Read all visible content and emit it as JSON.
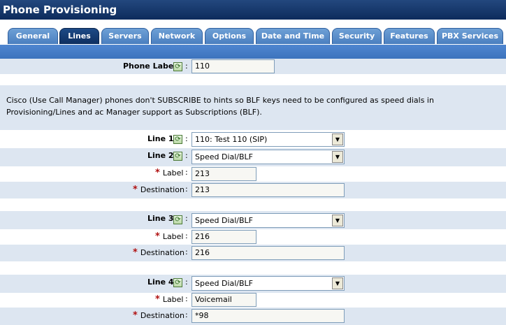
{
  "header": {
    "title": "Phone Provisioning"
  },
  "tabs": [
    {
      "label": "General"
    },
    {
      "label": "Lines"
    },
    {
      "label": "Servers"
    },
    {
      "label": "Network"
    },
    {
      "label": "Options"
    },
    {
      "label": "Date and Time"
    },
    {
      "label": "Security"
    },
    {
      "label": "Features"
    },
    {
      "label": "PBX Services"
    }
  ],
  "active_tab": "Lines",
  "phone_label": {
    "label": "Phone Label",
    "value": "110"
  },
  "notice": "Cisco (Use Call Manager) phones don't SUBSCRIBE to hints so BLF keys need to be configured as speed dials in Provisioning/Lines and ac Manager support as Subscriptions (BLF).",
  "colon": ":",
  "icons": {
    "refresh": "refresh-icon",
    "dropdown": "chevron-down-icon",
    "required": "required-star-icon"
  },
  "colors": {
    "header": "#0d2b5c",
    "tab": "#5a8ccc",
    "active_tab": "#133b72",
    "shade": "#dde6f1",
    "required": "#b01010"
  },
  "lines": [
    {
      "label": "Line 1",
      "value": "110: Test 110 (SIP)"
    },
    {
      "label": "Line 2",
      "value": "Speed Dial/BLF",
      "field_label": "Label",
      "field_value": "213",
      "dest_label": "Destination",
      "dest_value": "213"
    },
    {
      "label": "Line 3",
      "value": "Speed Dial/BLF",
      "field_label": "Label",
      "field_value": "216",
      "dest_label": "Destination",
      "dest_value": "216"
    },
    {
      "label": "Line 4",
      "value": "Speed Dial/BLF",
      "field_label": "Label",
      "field_value": "Voicemail",
      "dest_label": "Destination",
      "dest_value": "*98"
    }
  ]
}
